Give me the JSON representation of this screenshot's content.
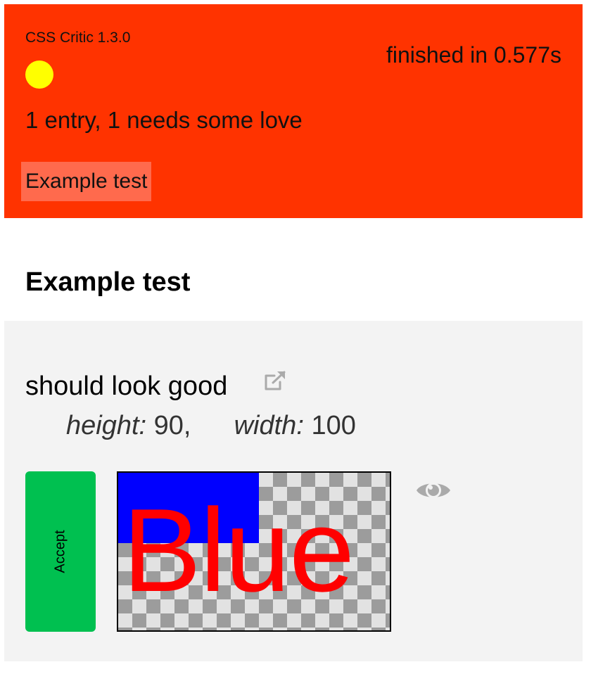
{
  "header": {
    "app_title": "CSS Critic 1.3.0",
    "finished": "finished in 0.577s",
    "summary": "1 entry, 1 needs some love",
    "entry_link": "Example test",
    "status_color": "#ffff00",
    "background_color": "#ff3300"
  },
  "section": {
    "title": "Example test"
  },
  "test": {
    "name": "should look good",
    "external_icon": "external-link-icon",
    "height_label": "height:",
    "height_value": "90,",
    "width_label": "width:",
    "width_value": "100",
    "accept_label": "Accept",
    "accept_color": "#00c050",
    "render_text": "Blue",
    "eye_icon": "eye-icon"
  }
}
